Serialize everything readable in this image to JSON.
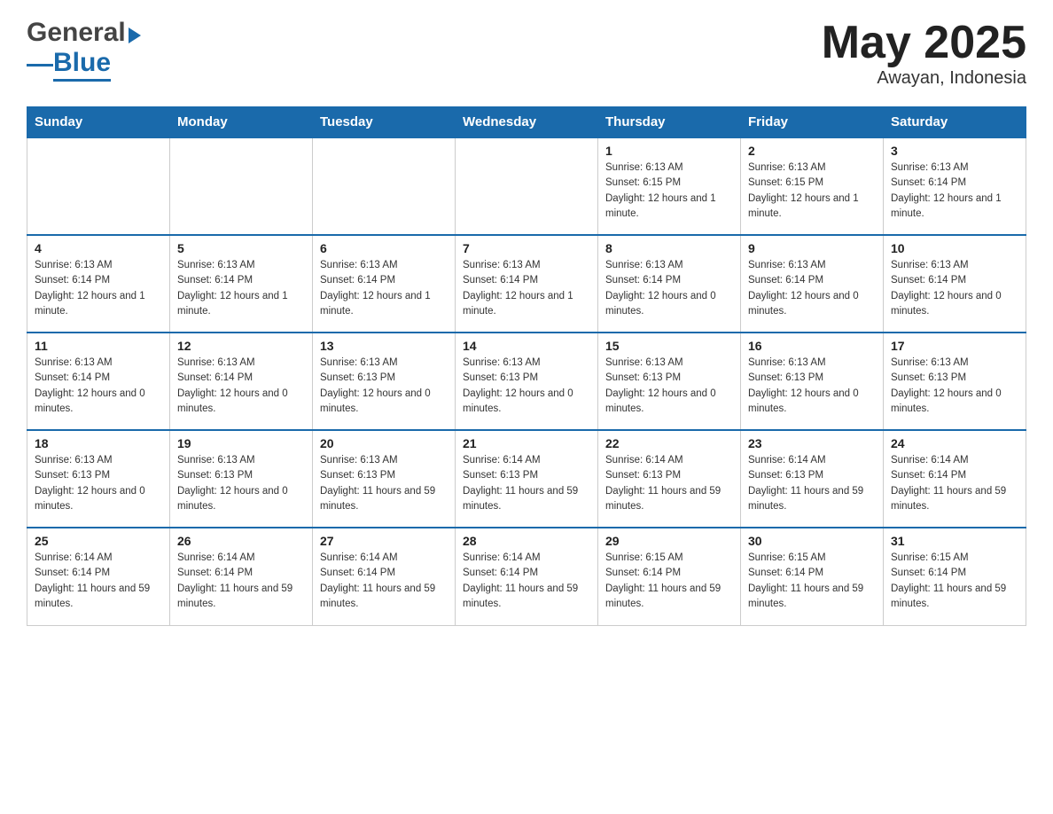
{
  "header": {
    "logo_general": "General",
    "logo_blue": "Blue",
    "month_title": "May 2025",
    "location": "Awayan, Indonesia"
  },
  "days_of_week": [
    "Sunday",
    "Monday",
    "Tuesday",
    "Wednesday",
    "Thursday",
    "Friday",
    "Saturday"
  ],
  "weeks": [
    {
      "days": [
        {
          "number": "",
          "sunrise": "",
          "sunset": "",
          "daylight": ""
        },
        {
          "number": "",
          "sunrise": "",
          "sunset": "",
          "daylight": ""
        },
        {
          "number": "",
          "sunrise": "",
          "sunset": "",
          "daylight": ""
        },
        {
          "number": "",
          "sunrise": "",
          "sunset": "",
          "daylight": ""
        },
        {
          "number": "1",
          "sunrise": "Sunrise: 6:13 AM",
          "sunset": "Sunset: 6:15 PM",
          "daylight": "Daylight: 12 hours and 1 minute."
        },
        {
          "number": "2",
          "sunrise": "Sunrise: 6:13 AM",
          "sunset": "Sunset: 6:15 PM",
          "daylight": "Daylight: 12 hours and 1 minute."
        },
        {
          "number": "3",
          "sunrise": "Sunrise: 6:13 AM",
          "sunset": "Sunset: 6:14 PM",
          "daylight": "Daylight: 12 hours and 1 minute."
        }
      ]
    },
    {
      "days": [
        {
          "number": "4",
          "sunrise": "Sunrise: 6:13 AM",
          "sunset": "Sunset: 6:14 PM",
          "daylight": "Daylight: 12 hours and 1 minute."
        },
        {
          "number": "5",
          "sunrise": "Sunrise: 6:13 AM",
          "sunset": "Sunset: 6:14 PM",
          "daylight": "Daylight: 12 hours and 1 minute."
        },
        {
          "number": "6",
          "sunrise": "Sunrise: 6:13 AM",
          "sunset": "Sunset: 6:14 PM",
          "daylight": "Daylight: 12 hours and 1 minute."
        },
        {
          "number": "7",
          "sunrise": "Sunrise: 6:13 AM",
          "sunset": "Sunset: 6:14 PM",
          "daylight": "Daylight: 12 hours and 1 minute."
        },
        {
          "number": "8",
          "sunrise": "Sunrise: 6:13 AM",
          "sunset": "Sunset: 6:14 PM",
          "daylight": "Daylight: 12 hours and 0 minutes."
        },
        {
          "number": "9",
          "sunrise": "Sunrise: 6:13 AM",
          "sunset": "Sunset: 6:14 PM",
          "daylight": "Daylight: 12 hours and 0 minutes."
        },
        {
          "number": "10",
          "sunrise": "Sunrise: 6:13 AM",
          "sunset": "Sunset: 6:14 PM",
          "daylight": "Daylight: 12 hours and 0 minutes."
        }
      ]
    },
    {
      "days": [
        {
          "number": "11",
          "sunrise": "Sunrise: 6:13 AM",
          "sunset": "Sunset: 6:14 PM",
          "daylight": "Daylight: 12 hours and 0 minutes."
        },
        {
          "number": "12",
          "sunrise": "Sunrise: 6:13 AM",
          "sunset": "Sunset: 6:14 PM",
          "daylight": "Daylight: 12 hours and 0 minutes."
        },
        {
          "number": "13",
          "sunrise": "Sunrise: 6:13 AM",
          "sunset": "Sunset: 6:13 PM",
          "daylight": "Daylight: 12 hours and 0 minutes."
        },
        {
          "number": "14",
          "sunrise": "Sunrise: 6:13 AM",
          "sunset": "Sunset: 6:13 PM",
          "daylight": "Daylight: 12 hours and 0 minutes."
        },
        {
          "number": "15",
          "sunrise": "Sunrise: 6:13 AM",
          "sunset": "Sunset: 6:13 PM",
          "daylight": "Daylight: 12 hours and 0 minutes."
        },
        {
          "number": "16",
          "sunrise": "Sunrise: 6:13 AM",
          "sunset": "Sunset: 6:13 PM",
          "daylight": "Daylight: 12 hours and 0 minutes."
        },
        {
          "number": "17",
          "sunrise": "Sunrise: 6:13 AM",
          "sunset": "Sunset: 6:13 PM",
          "daylight": "Daylight: 12 hours and 0 minutes."
        }
      ]
    },
    {
      "days": [
        {
          "number": "18",
          "sunrise": "Sunrise: 6:13 AM",
          "sunset": "Sunset: 6:13 PM",
          "daylight": "Daylight: 12 hours and 0 minutes."
        },
        {
          "number": "19",
          "sunrise": "Sunrise: 6:13 AM",
          "sunset": "Sunset: 6:13 PM",
          "daylight": "Daylight: 12 hours and 0 minutes."
        },
        {
          "number": "20",
          "sunrise": "Sunrise: 6:13 AM",
          "sunset": "Sunset: 6:13 PM",
          "daylight": "Daylight: 11 hours and 59 minutes."
        },
        {
          "number": "21",
          "sunrise": "Sunrise: 6:14 AM",
          "sunset": "Sunset: 6:13 PM",
          "daylight": "Daylight: 11 hours and 59 minutes."
        },
        {
          "number": "22",
          "sunrise": "Sunrise: 6:14 AM",
          "sunset": "Sunset: 6:13 PM",
          "daylight": "Daylight: 11 hours and 59 minutes."
        },
        {
          "number": "23",
          "sunrise": "Sunrise: 6:14 AM",
          "sunset": "Sunset: 6:13 PM",
          "daylight": "Daylight: 11 hours and 59 minutes."
        },
        {
          "number": "24",
          "sunrise": "Sunrise: 6:14 AM",
          "sunset": "Sunset: 6:14 PM",
          "daylight": "Daylight: 11 hours and 59 minutes."
        }
      ]
    },
    {
      "days": [
        {
          "number": "25",
          "sunrise": "Sunrise: 6:14 AM",
          "sunset": "Sunset: 6:14 PM",
          "daylight": "Daylight: 11 hours and 59 minutes."
        },
        {
          "number": "26",
          "sunrise": "Sunrise: 6:14 AM",
          "sunset": "Sunset: 6:14 PM",
          "daylight": "Daylight: 11 hours and 59 minutes."
        },
        {
          "number": "27",
          "sunrise": "Sunrise: 6:14 AM",
          "sunset": "Sunset: 6:14 PM",
          "daylight": "Daylight: 11 hours and 59 minutes."
        },
        {
          "number": "28",
          "sunrise": "Sunrise: 6:14 AM",
          "sunset": "Sunset: 6:14 PM",
          "daylight": "Daylight: 11 hours and 59 minutes."
        },
        {
          "number": "29",
          "sunrise": "Sunrise: 6:15 AM",
          "sunset": "Sunset: 6:14 PM",
          "daylight": "Daylight: 11 hours and 59 minutes."
        },
        {
          "number": "30",
          "sunrise": "Sunrise: 6:15 AM",
          "sunset": "Sunset: 6:14 PM",
          "daylight": "Daylight: 11 hours and 59 minutes."
        },
        {
          "number": "31",
          "sunrise": "Sunrise: 6:15 AM",
          "sunset": "Sunset: 6:14 PM",
          "daylight": "Daylight: 11 hours and 59 minutes."
        }
      ]
    }
  ]
}
